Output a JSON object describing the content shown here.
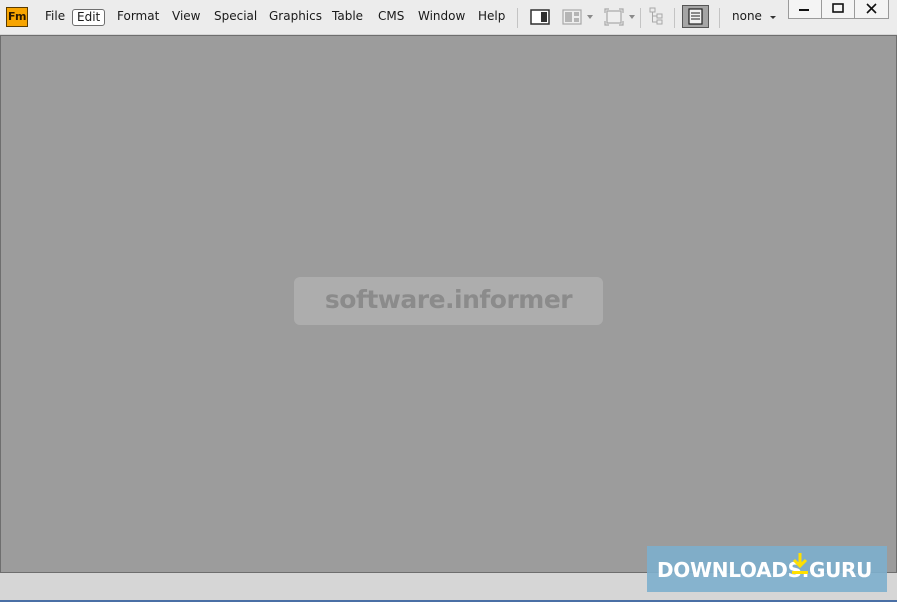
{
  "app": {
    "logo_text": "Fm",
    "brand_color": "#f7a400"
  },
  "menu": {
    "items": [
      {
        "label": "File"
      },
      {
        "label": "Edit",
        "active": true
      },
      {
        "label": "Format"
      },
      {
        "label": "View"
      },
      {
        "label": "Special"
      },
      {
        "label": "Graphics"
      },
      {
        "label": "Table"
      },
      {
        "label": "CMS"
      },
      {
        "label": "Window"
      },
      {
        "label": "Help"
      }
    ]
  },
  "toolbar": {
    "icons": [
      "pod-panel-icon",
      "layout-grid-icon",
      "zoom-fit-icon",
      "structure-tree-icon",
      "page-layout-icon"
    ],
    "view_select_value": "none"
  },
  "window_controls": {
    "icons": [
      "minimize-icon",
      "maximize-icon",
      "close-icon"
    ]
  },
  "workspace": {
    "background": "#9c9c9c"
  },
  "watermarks": {
    "software_informer": "software.informer",
    "downloads_guru_left": "DOWNLOADS",
    "downloads_guru_right": ".GURU"
  }
}
